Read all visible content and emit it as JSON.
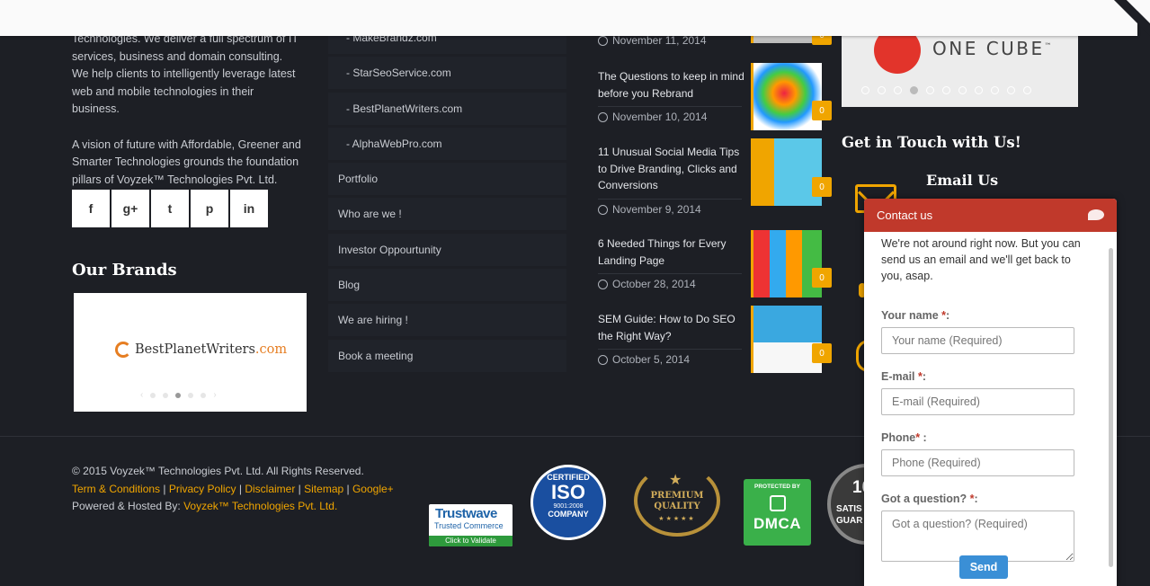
{
  "about": {
    "para1": "Technologies. We deliver a full spectrum of IT services, business and domain consulting. We help clients to intelligently leverage latest web and mobile technologies in their business.",
    "para2": "A vision of future with Affordable, Greener and Smarter Technologies grounds the foundation pillars of Voyzek™ Technologies Pvt. Ltd."
  },
  "social": [
    "f",
    "g+",
    "t",
    "p",
    "in"
  ],
  "brands": {
    "title": "Our Brands",
    "logo_main": "BestPlanetWriters",
    "logo_suffix": ".com"
  },
  "links": [
    {
      "label": "- MakeBrandz.com",
      "sub": true
    },
    {
      "label": "- StarSeoService.com",
      "sub": true
    },
    {
      "label": "- BestPlanetWriters.com",
      "sub": true
    },
    {
      "label": "- AlphaWebPro.com",
      "sub": true
    },
    {
      "label": "Portfolio",
      "sub": false
    },
    {
      "label": "Who are we !",
      "sub": false
    },
    {
      "label": "Investor Oppourtunity",
      "sub": false
    },
    {
      "label": "Blog",
      "sub": false
    },
    {
      "label": "We are hiring !",
      "sub": false
    },
    {
      "label": "Book a meeting",
      "sub": false
    }
  ],
  "posts": [
    {
      "title": "",
      "date": "November 11, 2014",
      "comments": "0"
    },
    {
      "title": "The Questions to keep in mind before you Rebrand",
      "date": "November 10, 2014",
      "comments": "0"
    },
    {
      "title": "11 Unusual Social Media Tips to Drive Branding, Clicks and Conversions",
      "date": "November 9, 2014",
      "comments": "0"
    },
    {
      "title": "6 Needed Things for Every Landing Page",
      "date": "October 28, 2014",
      "comments": "0"
    },
    {
      "title": "SEM Guide: How to Do SEO the Right Way?",
      "date": "October 5, 2014",
      "comments": "0"
    }
  ],
  "onecube": {
    "name": "ONE CUBE",
    "tm": "™"
  },
  "contact_section": {
    "title": "Get in Touch with Us!",
    "email_heading": "Email Us"
  },
  "footer": {
    "copyright": "© 2015 Voyzek™ Technologies Pvt. Ltd. All Rights Reserved.",
    "links": [
      "Term & Conditions",
      "Privacy Policy",
      "Disclaimer",
      "Sitemap",
      "Google+"
    ],
    "hosted_prefix": "Powered & Hosted By: ",
    "hosted_link": "Voyzek™ Technologies Pvt. Ltd."
  },
  "badges": {
    "trustwave": {
      "name": "Trustwave",
      "sub": "Trusted Commerce",
      "cta": "Click to Validate"
    },
    "iso": {
      "top": "CERTIFIED",
      "mid": "ISO",
      "code": "9001:2008",
      "bottom": "COMPANY"
    },
    "premium": {
      "line1": "PREMIUM",
      "line2": "QUALITY"
    },
    "dmca": {
      "top": "PROTECTED BY",
      "main": "DMCA"
    },
    "satisfaction": {
      "num": "10",
      "text1": "SATIS",
      "text2": "GUAR"
    }
  },
  "contact_widget": {
    "header": "Contact us",
    "intro": "We're not around right now. But you can send us an email and we'll get back to you, asap.",
    "fields": [
      {
        "label": "Your name ",
        "req": "*",
        "colon": ":",
        "placeholder": "Your name (Required)"
      },
      {
        "label": "E-mail ",
        "req": "*",
        "colon": ":",
        "placeholder": "E-mail (Required)"
      },
      {
        "label": "Phone",
        "req": "*",
        "colon": " :",
        "placeholder": "Phone (Required)"
      },
      {
        "label": "Got a question? ",
        "req": "*",
        "colon": ":",
        "placeholder": "Got a question? (Required)"
      }
    ],
    "send": "Send"
  },
  "colors": {
    "accent": "#f0a500",
    "widget_header": "#c0392b",
    "send_button": "#3a8fd6",
    "background": "#1d1f25"
  }
}
